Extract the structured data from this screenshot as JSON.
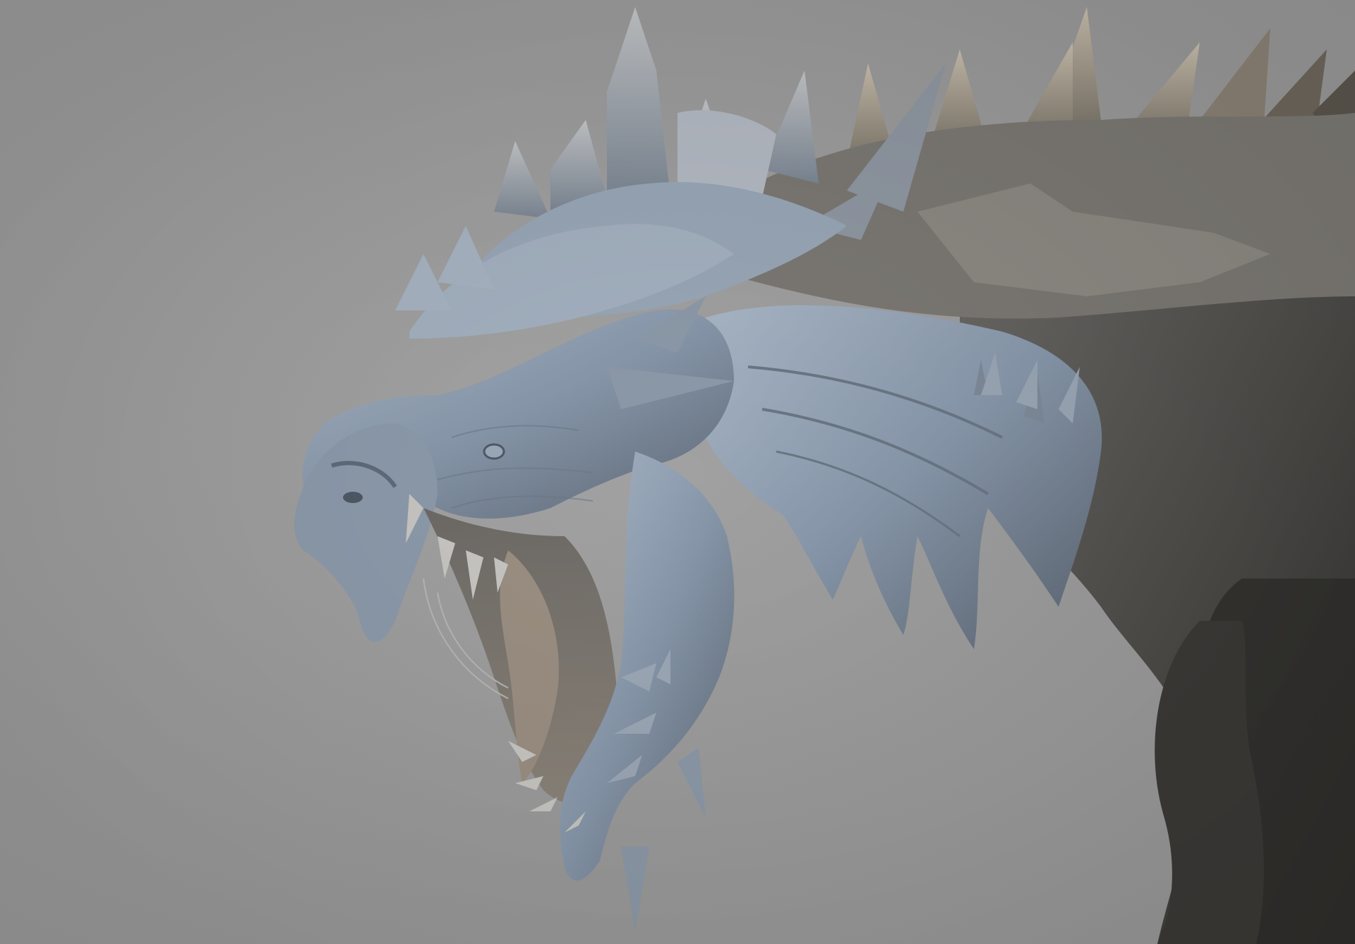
{
  "scene": {
    "subject": "dragon-sculpt-render",
    "background_color": "#9a9a9a",
    "material_light": "#8a9cb0",
    "material_mid": "#6f7c8c",
    "material_dark": "#3f3d3a",
    "material_warm": "#9a8e7e"
  }
}
